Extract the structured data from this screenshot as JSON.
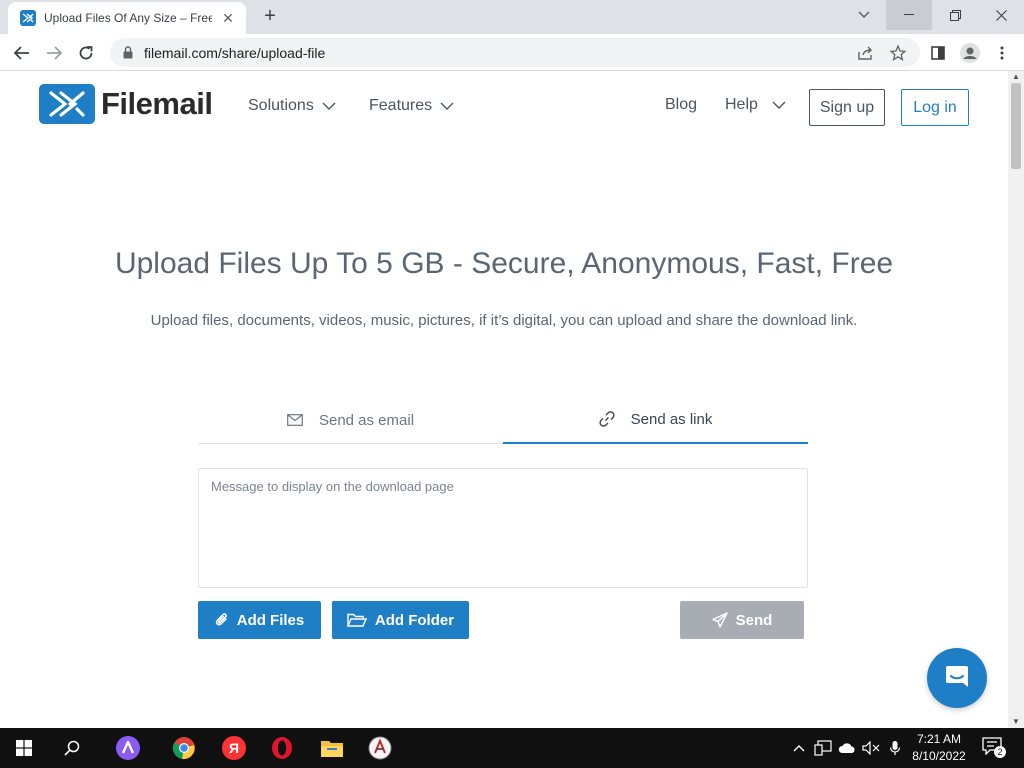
{
  "browser": {
    "tab_title": "Upload Files Of Any Size – Free U",
    "tab_close": "✕",
    "new_tab": "+",
    "url": "filemail.com/share/upload-file"
  },
  "site": {
    "brand": "Filemail",
    "accent_color": "#1f7fc6",
    "nav": {
      "solutions": "Solutions",
      "features": "Features",
      "blog": "Blog",
      "help": "Help",
      "sign_up": "Sign up",
      "log_in": "Log in"
    },
    "hero": {
      "title": "Upload Files Up To 5 GB - Secure, Anonymous, Fast, Free",
      "subtitle": "Upload files, documents, videos, music, pictures, if it’s digital, you can upload and share the download link."
    },
    "mode_tabs": {
      "email": "Send as email",
      "link": "Send as link",
      "active": "link"
    },
    "message": {
      "placeholder": "Message to display on the download page",
      "value": ""
    },
    "actions": {
      "add_files": "Add Files",
      "add_folder": "Add Folder",
      "send": "Send",
      "send_disabled": true
    }
  },
  "taskbar": {
    "time": "7:21 AM",
    "date": "8/10/2022",
    "notification_count": "2"
  }
}
